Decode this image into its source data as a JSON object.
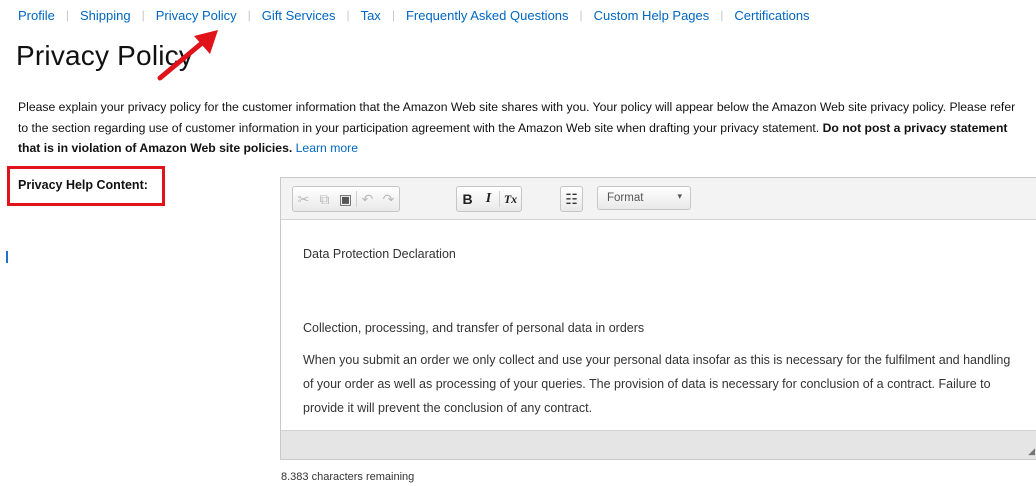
{
  "nav": {
    "items": [
      "Profile",
      "Shipping",
      "Privacy Policy",
      "Gift Services",
      "Tax",
      "Frequently Asked Questions",
      "Custom Help Pages",
      "Certifications"
    ],
    "separator": "|"
  },
  "page_title": "Privacy Policy",
  "description": {
    "text": "Please explain your privacy policy for the customer information that the Amazon Web site shares with you. Your policy will appear below the Amazon Web site privacy policy. Please refer to the section regarding use of customer information in your participation agreement with the Amazon Web site when drafting your privacy statement. ",
    "bold": "Do not post a privacy statement that is in violation of Amazon Web site policies.",
    "link": "Learn more"
  },
  "help_label": "Privacy Help Content:",
  "editor": {
    "toolbar": {
      "cut_icon": "✂",
      "copy_icon": "⧉",
      "paste_icon": "▣",
      "undo_icon": "↶",
      "redo_icon": "↷",
      "bold_label": "B",
      "italic_label": "I",
      "clear_format_label": "Tx",
      "list_icon": "☷",
      "format_value": "Format"
    },
    "content": [
      "Data Protection Declaration",
      "Collection, processing, and transfer of personal data in orders",
      "When you submit an order we only collect and use your personal data insofar as this is necessary for the fulfilment and handling of your order as well as processing of your queries. The provision of data is necessary for conclusion of a contract. Failure to provide it will prevent the conclusion of any contract."
    ]
  },
  "chars_remaining": "8.383 characters remaining",
  "colors": {
    "link": "#0066c0",
    "annotation_red": "#e0121a"
  }
}
